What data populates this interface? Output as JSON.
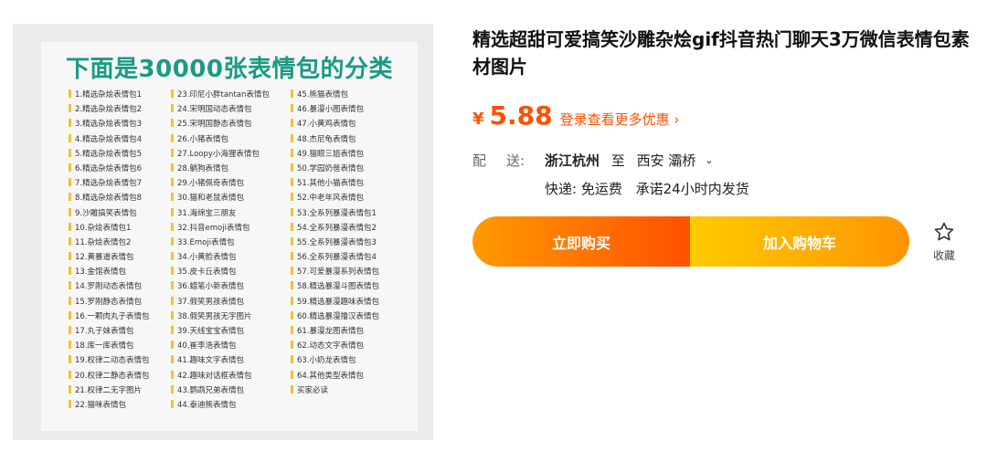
{
  "gallery": {
    "promo_title": "下面是30000张表情包的分类",
    "columns": [
      [
        "1.精选杂烩表情包1",
        "2.精选杂烩表情包2",
        "3.精选杂烩表情包3",
        "4.精选杂烩表情包4",
        "5.精选杂烩表情包5",
        "6.精选杂烩表情包6",
        "7.精选杂烩表情包7",
        "8.精选杂烩表情包8",
        "9.沙雕搞笑表情包",
        "10.杂烩表情包1",
        "11.杂烩表情包2",
        "12.黄暴道表情包",
        "13.金馆表情包",
        "14.罗刚动态表情包",
        "15.罗刚静态表情包",
        "16.一颗肉丸子表情包",
        "17.丸子妹表情包",
        "18.库一库表情包",
        "19.权律二动态表情包",
        "20.权律二静态表情包",
        "21.权律二无字图片",
        "22.猫咪表情包"
      ],
      [
        "23.印尼小胖tantan表情包",
        "24.宋明国动态表情包",
        "25.宋明国静态表情包",
        "26.小猪表情包",
        "27.Loopy小海狸表情包",
        "28.躺狗表情包",
        "29.小猪佩奇表情包",
        "30.猫和老鼠表情包",
        "31.海绵宝三朋友",
        "32.抖音emoji表情包",
        "33.Emoji表情包",
        "34.小黄脸表情包",
        "35.皮卡丘表情包",
        "36.蜡笔小新表情包",
        "37.假笑男孩表情包",
        "38.假笑男孩无字图片",
        "39.天线宝宝表情包",
        "40.崔李浩表情包",
        "41.趣味文字表情包",
        "42.趣味对话框表情包",
        "43.鹦鹉兄弟表情包",
        "44.泰迪熊表情包"
      ],
      [
        "45.熊猫表情包",
        "46.暴漫小图表情包",
        "47.小黄鸡表情包",
        "48.杰尼龟表情包",
        "49.猫眼三姐表情包",
        "50.学园奶爸表情包",
        "51.其他小猫表情包",
        "52.中老年风表情包",
        "53.全系列暴漫表情包1",
        "54.全系列暴漫表情包2",
        "55.全系列暴漫表情包3",
        "56.全系列暴漫表情包4",
        "57.可爱暴漫系列表情包",
        "58.精选暴漫斗图表情包",
        "59.精选暴漫趣味表情包",
        "60.精选暴漫撸汉表情包",
        "61.暴漫龙图表情包",
        "62.动态文字表情包",
        "63.小奶龙表情包",
        "64.其他类型表情包",
        "买家必读"
      ]
    ]
  },
  "product": {
    "title": "精选超甜可爱搞笑沙雕杂烩gif抖音热门聊天3万微信表情包素材图片",
    "price_symbol": "¥",
    "price": "5.88",
    "login_link": "登录查看更多优惠 ›",
    "shipping": {
      "label_1": "配",
      "label_2": "送:",
      "origin": "浙江杭州",
      "to": "至",
      "dest": "西安 灞桥",
      "express": "快递: 免运费",
      "promise": "承诺24小时内发货"
    },
    "buy_now": "立即购买",
    "add_to_cart": "加入购物车",
    "favorite": "收藏"
  },
  "colors": {
    "accent": "#ff5000",
    "promo_title": "#1a9a86",
    "buy_gradient": [
      "#ff9a00",
      "#ff5000"
    ],
    "cart_gradient": [
      "#ffcb00",
      "#ff9402"
    ]
  },
  "icons": [
    "chevron-down-icon",
    "star-icon"
  ]
}
